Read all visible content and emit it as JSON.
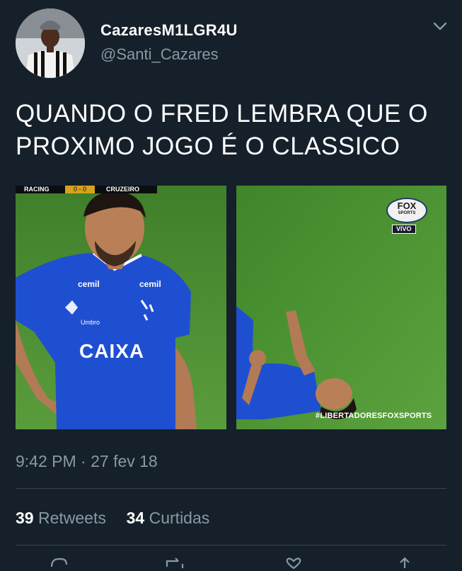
{
  "tweet": {
    "display_name": "CazaresM1LGR4U",
    "handle": "@Santi_Cazares",
    "text_lines": [
      "QUANDO O FRED LEMBRA QUE O",
      "PROXIMO JOGO É O CLASSICO"
    ],
    "time": "9:42 PM · 27 fev 18"
  },
  "media": {
    "left_image": {
      "score_home": "RACING",
      "score_value": "0 - 0",
      "score_away": "CRUZEIRO",
      "jersey_sponsor": "CAIXA",
      "jersey_chest_brand": "cemil",
      "jersey_kit_brand": "Umbro"
    },
    "right_image": {
      "channel_logo": "FOX",
      "channel_logo_sub": "SPORTS",
      "live_badge": "VIVO",
      "hashtag": "#LIBERTADORESFOXSPORTS"
    }
  },
  "stats": {
    "retweets_count": "39",
    "retweets_label": "Retweets",
    "likes_count": "34",
    "likes_label": "Curtidas"
  },
  "icons": {
    "menu": "chevron-down-icon",
    "reply": "reply-icon",
    "retweet": "retweet-icon",
    "like": "heart-icon",
    "share": "share-icon"
  },
  "colors": {
    "background": "#15202b",
    "text_primary": "#ffffff",
    "text_secondary": "#8899a6",
    "divider": "#38444d",
    "jersey_blue": "#1f4fd1",
    "pitch_green": "#4e8f34"
  }
}
